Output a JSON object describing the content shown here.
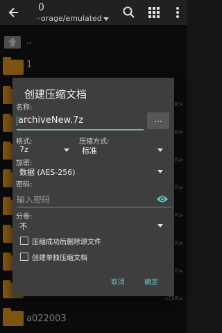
{
  "appbar": {
    "count": "0",
    "path": "orage/emulated",
    "path_prefix": "··"
  },
  "files": [
    {
      "name": "..",
      "tag": ""
    },
    {
      "name": "1",
      "tag": ""
    },
    {
      "name": "",
      "tag": "<DIR>"
    },
    {
      "name": "",
      "tag": "<DIR>"
    },
    {
      "name": "",
      "tag": "<DIR>"
    },
    {
      "name": "",
      "tag": "<DIR>"
    },
    {
      "name": "",
      "tag": "<DIR>"
    },
    {
      "name": "",
      "tag": "<DIR>"
    },
    {
      "name": "",
      "tag": "<DIR>"
    },
    {
      "name": "",
      "tag": "<DIR>"
    },
    {
      "name": "a022003",
      "tag": ""
    }
  ],
  "dialog": {
    "title": "创建压缩文档",
    "name_label": "名称:",
    "name_value": "archiveNew.7z",
    "browse_label": "...",
    "format_label": "格式:",
    "format_value": "7z",
    "method_label": "压缩方式:",
    "method_value": "标准",
    "encrypt_label": "加密:",
    "encrypt_value": "数据 (AES-256)",
    "password_label": "密码:",
    "password_placeholder": "输入密码",
    "split_label": "分卷:",
    "split_value": "不",
    "delete_source_label": "压缩成功后删除源文件",
    "separate_label": "创建单独压缩文档",
    "cancel_label": "取消",
    "ok_label": "确定"
  },
  "colors": {
    "accent": "#5ec5bd",
    "folder": "#e69a24",
    "dialog_bg": "#3e3e3e"
  }
}
